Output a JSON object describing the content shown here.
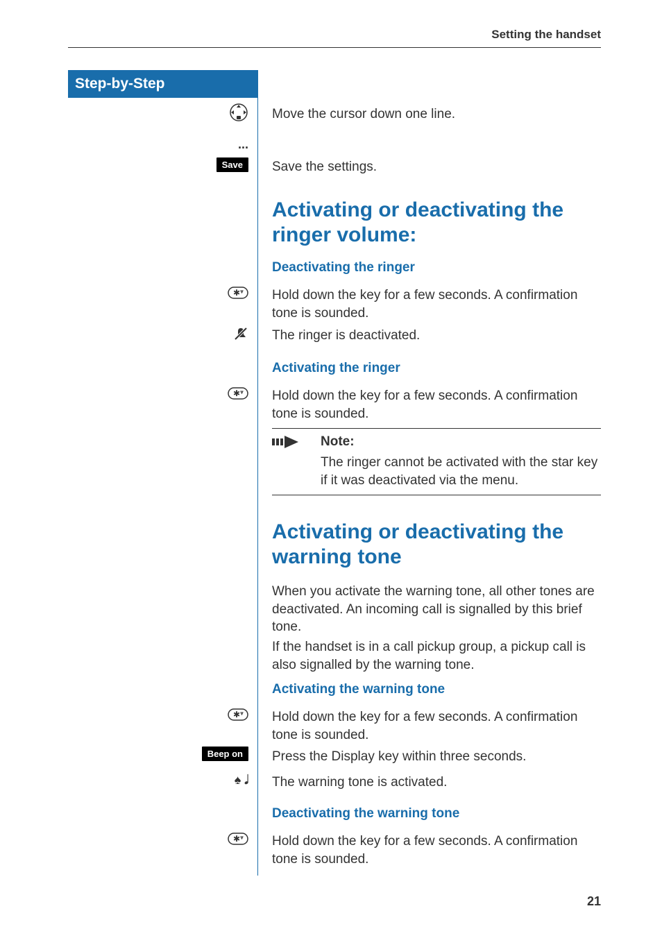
{
  "header": {
    "section": "Setting the handset"
  },
  "sidebar": {
    "title": "Step-by-Step"
  },
  "steps": {
    "cursor": {
      "text": "Move the cursor down one line."
    },
    "ellipsis": "...",
    "save": {
      "pill": "Save",
      "text": "Save the settings."
    }
  },
  "ringer": {
    "heading": "Activating or deactivating the ringer volume:",
    "deact_sub": "Deactivating the ringer",
    "deact_text": "Hold down the key for a few seconds. A confirmation tone is sounded.",
    "deact_done": "The ringer is deactivated.",
    "act_sub": "Activating the ringer",
    "act_text": "Hold down the key for a few seconds. A confirmation tone is sounded."
  },
  "note": {
    "title": "Note:",
    "text": "The ringer cannot be activated with the star key if it was deactivated via the menu."
  },
  "warning": {
    "heading": "Activating or deactivating the warning tone",
    "intro1": "When you activate the warning tone, all other tones are deactivated. An incoming call is signalled by this brief tone.",
    "intro2": "If the handset is in a call pickup group, a pickup call is also signalled by the warning tone.",
    "act_sub": "Activating the warning tone",
    "act_text": "Hold down the key for a few seconds. A confirmation tone is sounded.",
    "beep_pill": "Beep on",
    "beep_text": "Press the Display key within three seconds.",
    "done": "The warning tone is activated.",
    "deact_sub": "Deactivating the warning tone",
    "deact_text": "Hold down the key for a few seconds. A confirmation tone is sounded."
  },
  "page": "21"
}
